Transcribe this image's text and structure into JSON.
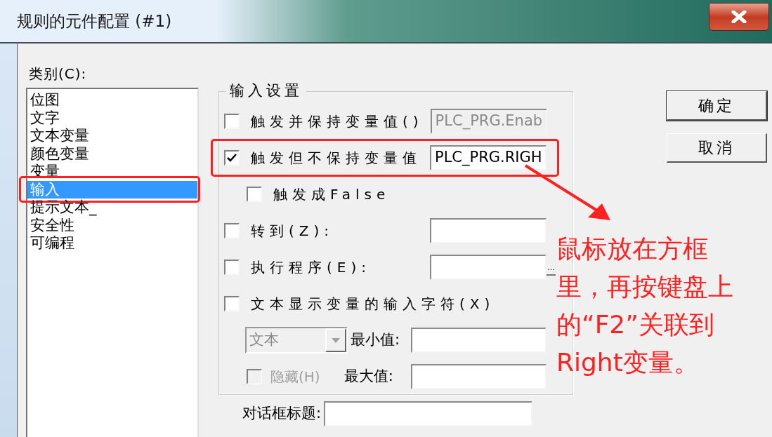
{
  "window": {
    "title": "规则的元件配置 (#1)"
  },
  "category": {
    "label": "类别(C):",
    "items": [
      {
        "label": "位图",
        "selected": false,
        "highlighted": false
      },
      {
        "label": "文字",
        "selected": false,
        "highlighted": false
      },
      {
        "label": "文本变量",
        "selected": false,
        "highlighted": false
      },
      {
        "label": "颜色变量",
        "selected": false,
        "highlighted": false
      },
      {
        "label": "变量",
        "selected": false,
        "highlighted": false
      },
      {
        "label": "输入",
        "selected": true,
        "highlighted": true
      },
      {
        "label": "提示文本_",
        "selected": false,
        "highlighted": false
      },
      {
        "label": "安全性",
        "selected": false,
        "highlighted": false
      },
      {
        "label": "可编程",
        "selected": false,
        "highlighted": false
      }
    ]
  },
  "input_settings": {
    "title": "输入设置",
    "rows": [
      {
        "kind": "check_field",
        "label": "触发并保持变量值()",
        "checked": false,
        "value": "PLC_PRG.Enab",
        "field_enabled": false
      },
      {
        "kind": "check_field",
        "label": "触发但不保持变量值",
        "checked": true,
        "value": "PLC_PRG.RIGH",
        "field_enabled": true,
        "highlighted": true
      },
      {
        "kind": "sub_check",
        "label": "触发成False",
        "checked": false
      },
      {
        "kind": "check_field",
        "label": "转到(Z):",
        "checked": false,
        "field_enabled": true
      },
      {
        "kind": "check_field",
        "label": "执行程序(E):",
        "checked": false,
        "field_enabled": true,
        "browse": "..."
      },
      {
        "kind": "check",
        "label": "文本显示变量的输入字符(X)",
        "checked": false
      },
      {
        "kind": "combo_field",
        "combo": "文本",
        "label": "最小值:"
      },
      {
        "kind": "sub_check_field",
        "check_label": "隐藏(H)",
        "checked": false,
        "disabled": true,
        "label": "最大值:"
      }
    ]
  },
  "dialog_title": {
    "label": "对话框标题:"
  },
  "buttons": [
    {
      "label": "确定",
      "default": true
    },
    {
      "label": "取消",
      "default": false
    }
  ],
  "annotation": {
    "lines": [
      "鼠标放在方框",
      "里，再按键盘上",
      "的“F2”关联到",
      "Right变量。"
    ]
  }
}
